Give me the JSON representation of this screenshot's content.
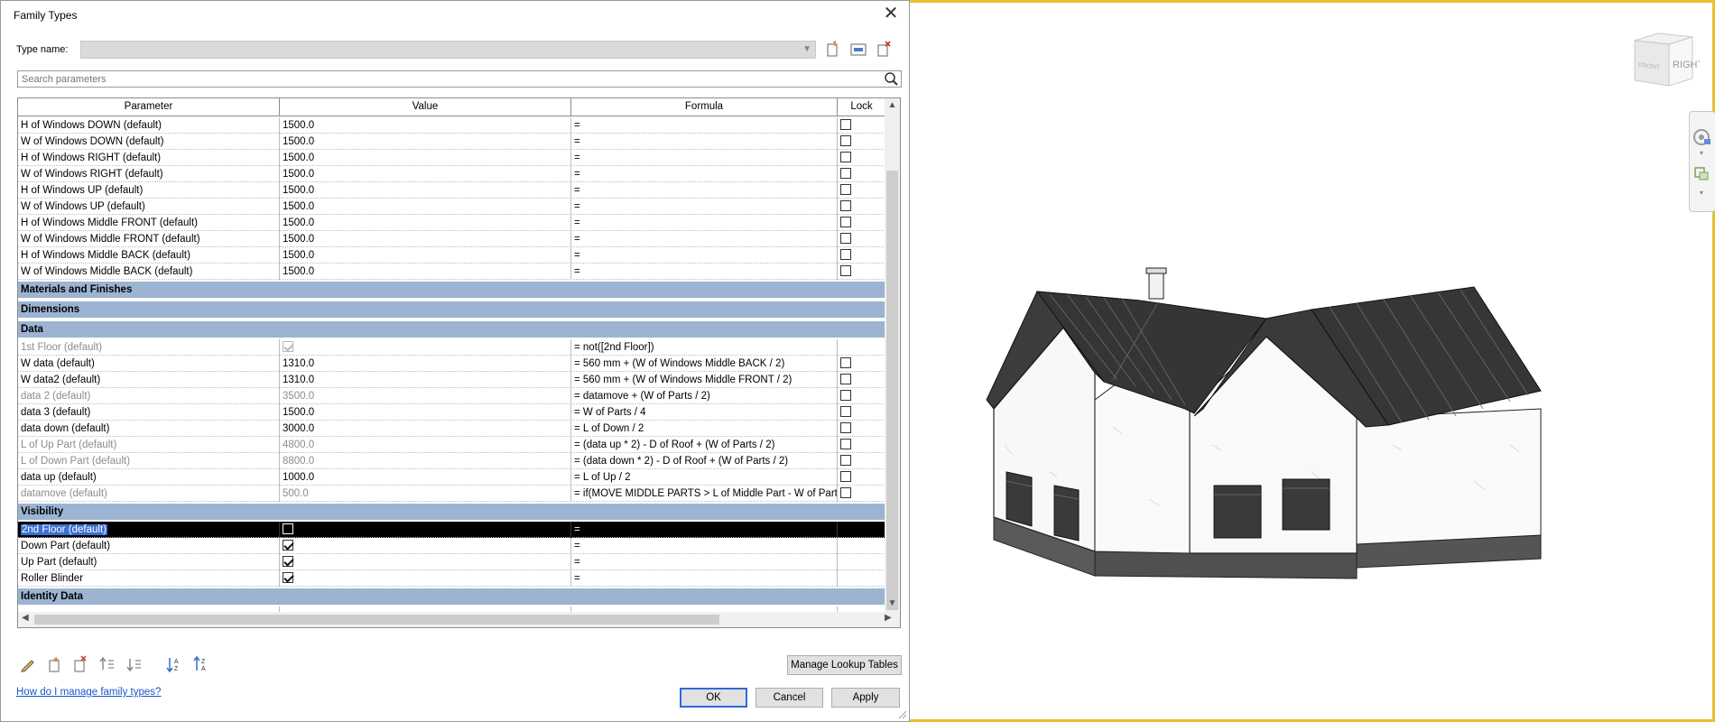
{
  "dialog": {
    "title": "Family Types",
    "type_name_label": "Type name:",
    "type_name_value": "",
    "search_placeholder": "Search parameters"
  },
  "grid": {
    "headers": {
      "parameter": "Parameter",
      "value": "Value",
      "formula": "Formula",
      "lock": "Lock"
    },
    "rows_top": [
      {
        "parameter": "H of Windows DOWN (default)",
        "value": "1500.0",
        "formula": "="
      },
      {
        "parameter": "W of Windows DOWN (default)",
        "value": "1500.0",
        "formula": "="
      },
      {
        "parameter": "H of Windows RIGHT (default)",
        "value": "1500.0",
        "formula": "="
      },
      {
        "parameter": "W of Windows RIGHT (default)",
        "value": "1500.0",
        "formula": "="
      },
      {
        "parameter": "H of Windows  UP (default)",
        "value": "1500.0",
        "formula": "="
      },
      {
        "parameter": "W of Windows UP (default)",
        "value": "1500.0",
        "formula": "="
      },
      {
        "parameter": "H of Windows Middle FRONT (default)",
        "value": "1500.0",
        "formula": "="
      },
      {
        "parameter": "W of Windows Middle FRONT (default)",
        "value": "1500.0",
        "formula": "="
      },
      {
        "parameter": "H of Windows Middle BACK (default)",
        "value": "1500.0",
        "formula": "="
      },
      {
        "parameter": "W of Windows Middle BACK (default)",
        "value": "1500.0",
        "formula": "="
      }
    ],
    "groups": {
      "materials": "Materials and Finishes",
      "dimensions": "Dimensions",
      "data": "Data",
      "visibility": "Visibility",
      "identity": "Identity Data"
    },
    "rows_data": [
      {
        "parameter": "1st Floor (default)",
        "value": "",
        "formula": "= not([2nd Floor])"
      },
      {
        "parameter": "W data (default)",
        "value": "1310.0",
        "formula": "= 560 mm + (W of Windows Middle BACK / 2)"
      },
      {
        "parameter": "W data2 (default)",
        "value": "1310.0",
        "formula": "= 560 mm + (W of Windows Middle FRONT / 2)"
      },
      {
        "parameter": "data 2 (default)",
        "value": "3500.0",
        "formula": "= datamove + (W of Parts / 2)"
      },
      {
        "parameter": "data 3 (default)",
        "value": "1500.0",
        "formula": "= W of Parts / 4"
      },
      {
        "parameter": "data down (default)",
        "value": "3000.0",
        "formula": "= L of Down / 2"
      },
      {
        "parameter": "L of Up Part (default)",
        "value": "4800.0",
        "formula": "= (data up * 2) - D of Roof + (W of Parts / 2)"
      },
      {
        "parameter": "L of Down Part (default)",
        "value": "8800.0",
        "formula": "= (data down * 2) - D of Roof + (W of Parts / 2)"
      },
      {
        "parameter": "data up (default)",
        "value": "1000.0",
        "formula": "= L of Up / 2"
      },
      {
        "parameter": "datamove (default)",
        "value": "500.0",
        "formula": "= if(MOVE MIDDLE PARTS > L of Middle Part - W of Part"
      }
    ],
    "rows_visibility": [
      {
        "parameter": "2nd Floor (default)",
        "formula": "="
      },
      {
        "parameter": "Down Part (default)",
        "formula": "="
      },
      {
        "parameter": "Up Part (default)",
        "formula": "="
      },
      {
        "parameter": "Roller Blinder",
        "formula": "="
      }
    ]
  },
  "buttons": {
    "manage_lookup": "Manage Lookup Tables",
    "ok": "OK",
    "cancel": "Cancel",
    "apply": "Apply"
  },
  "help_link": "How do I manage family types?",
  "viewcube": {
    "face_label": "RIGHT",
    "side_label": "FRONT"
  },
  "colors": {
    "group_header": "#9cb4d2",
    "viewport_border": "#e8c030",
    "link": "#1a56c8",
    "default_button_border": "#2f6bd6"
  }
}
